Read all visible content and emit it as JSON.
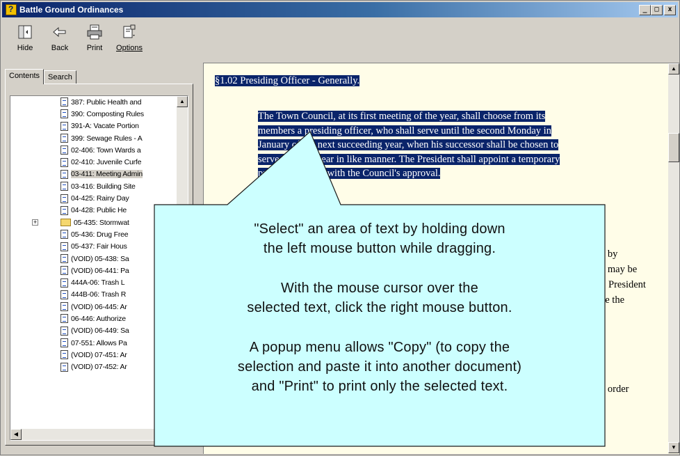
{
  "window": {
    "title": "Battle Ground Ordinances",
    "min_glyph": "_",
    "max_glyph": "□",
    "close_glyph": "x"
  },
  "toolbar": {
    "buttons": [
      {
        "label": "Hide",
        "icon": "hide-pane-icon"
      },
      {
        "label": "Back",
        "icon": "back-arrow-icon"
      },
      {
        "label": "Print",
        "icon": "printer-icon"
      },
      {
        "label": "Options",
        "icon": "options-icon"
      }
    ]
  },
  "left_pane": {
    "tabs": [
      {
        "label": "Contents",
        "active": true
      },
      {
        "label": "Search",
        "active": false
      }
    ],
    "tree_items": [
      {
        "text": "387:  Public Health and",
        "type": "doc"
      },
      {
        "text": "390:  Composting Rules",
        "type": "doc"
      },
      {
        "text": "391-A:  Vacate Portion",
        "type": "doc"
      },
      {
        "text": "399:  Sewage Rules - A",
        "type": "doc"
      },
      {
        "text": "02-406:  Town Wards a",
        "type": "doc"
      },
      {
        "text": "02-410:  Juvenile Curfe",
        "type": "doc"
      },
      {
        "text": "03-411:  Meeting Admin",
        "type": "doc",
        "selected": true
      },
      {
        "text": "03-416:  Building Site",
        "type": "doc"
      },
      {
        "text": "04-425:  Rainy Day",
        "type": "doc"
      },
      {
        "text": "04-428:  Public He",
        "type": "doc"
      },
      {
        "text": "05-435:  Stormwat",
        "type": "folder"
      },
      {
        "text": "05-436:  Drug Free",
        "type": "doc"
      },
      {
        "text": "05-437:  Fair Hous",
        "type": "doc"
      },
      {
        "text": "(VOID) 05-438:  Sa",
        "type": "doc"
      },
      {
        "text": "(VOID) 06-441:  Pa",
        "type": "doc"
      },
      {
        "text": "444A-06:  Trash L",
        "type": "doc"
      },
      {
        "text": "444B-06:  Trash R",
        "type": "doc"
      },
      {
        "text": "(VOID) 06-445:  Ar",
        "type": "doc"
      },
      {
        "text": "06-446:  Authorize",
        "type": "doc"
      },
      {
        "text": "(VOID) 06-449:  Sa",
        "type": "doc"
      },
      {
        "text": "07-551:  Allows Pa",
        "type": "doc"
      },
      {
        "text": "(VOID) 07-451:  Ar",
        "type": "doc"
      },
      {
        "text": "(VOID) 07-452:  Ar",
        "type": "doc"
      }
    ]
  },
  "content": {
    "heading": "§1.02   Presiding Officer - Generally.",
    "para1_lines": [
      "The Town Council, at its first meeting of the year, shall choose from its",
      "members a presiding officer, who shall serve until the second Monday in",
      "January of the next succeeding year, when his successor shall be chosen to",
      "serve the next year in like manner. The President shall appoint a temporary",
      "presiding officer with the Council's approval."
    ],
    "fragments": [
      "n by",
      "n may be",
      "President",
      "ve the",
      "o order"
    ]
  },
  "callout": {
    "lines_block1": [
      "\"Select\" an area of text by holding down",
      "the left mouse button while dragging."
    ],
    "lines_block2": [
      "With the mouse cursor over the",
      "selected text, click the right mouse button."
    ],
    "lines_block3": [
      "A popup menu allows \"Copy\" (to copy the",
      "selection and paste it into another document)",
      "and \"Print\" to print only the selected text."
    ],
    "fill_color": "#ccffff"
  }
}
